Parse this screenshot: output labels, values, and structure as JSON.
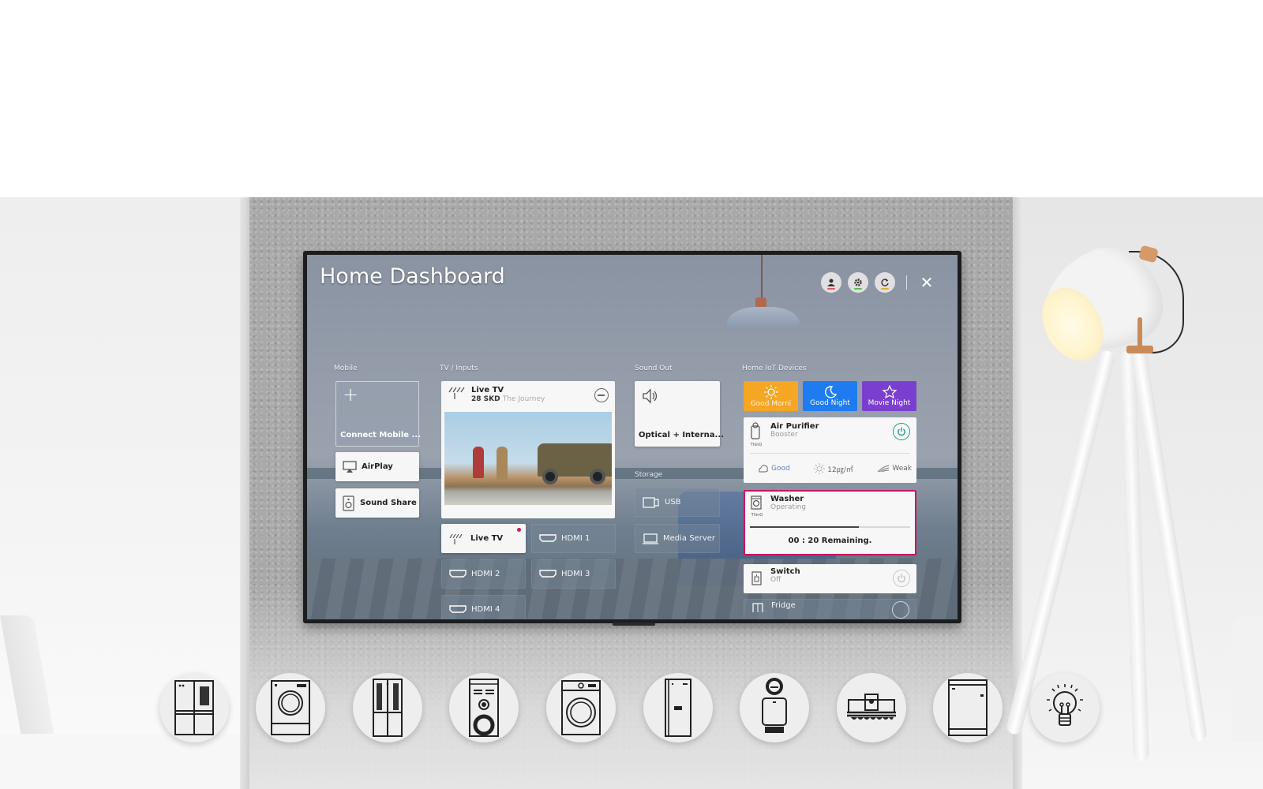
{
  "screen": {
    "title": "Home Dashboard",
    "top_icons": [
      {
        "name": "profile-icon",
        "indicator_color": "#e05a6a"
      },
      {
        "name": "settings-icon",
        "indicator_color": "#58c04a"
      },
      {
        "name": "refresh-icon",
        "indicator_color": "#e0b030"
      }
    ],
    "close_icon": "close-icon"
  },
  "mobile": {
    "label": "Mobile",
    "connect_label": "Connect Mobile ...",
    "items": [
      {
        "label": "AirPlay",
        "icon": "airplay-icon"
      },
      {
        "label": "Sound Share",
        "icon": "speaker-icon"
      }
    ]
  },
  "tv_inputs": {
    "label": "TV / Inputs",
    "live_card": {
      "title": "Live TV",
      "channel": "28 SKD",
      "program": "The Journey",
      "icon": "antenna-icon"
    },
    "inputs": [
      {
        "label": "Live TV",
        "icon": "antenna-icon",
        "active": true,
        "dot_color": "#d4145a"
      },
      {
        "label": "HDMI 1",
        "icon": "hdmi-icon",
        "active": false
      },
      {
        "label": "HDMI 2",
        "icon": "hdmi-icon",
        "active": false
      },
      {
        "label": "HDMI 3",
        "icon": "hdmi-icon",
        "active": false
      },
      {
        "label": "HDMI 4",
        "icon": "hdmi-icon",
        "active": false
      }
    ]
  },
  "sound_out": {
    "label": "Sound Out",
    "value": "Optical + Interna...",
    "icon": "volume-icon"
  },
  "storage": {
    "label": "Storage",
    "items": [
      {
        "label": "USB",
        "icon": "usb-icon"
      },
      {
        "label": "Media Server",
        "icon": "media-server-icon"
      }
    ]
  },
  "iot": {
    "label": "Home IoT Devices",
    "scenes": [
      {
        "label": "Good Morni",
        "icon": "sun-icon",
        "color": "#f5a623"
      },
      {
        "label": "Good Night",
        "icon": "moon-icon",
        "color": "#1f7cf0"
      },
      {
        "label": "Movie Night",
        "icon": "star-icon",
        "color": "#7b3fd0"
      }
    ],
    "devices": [
      {
        "name": "Air Purifier",
        "status": "Booster",
        "brand": "ThinQ",
        "power": "on",
        "power_color": "#1a9a8a",
        "metrics": [
          {
            "icon": "air-quality-icon",
            "value": "Good",
            "color": "#5a7fc0"
          },
          {
            "icon": "dust-icon",
            "value": "12㎍/㎥",
            "color": "#666666"
          },
          {
            "icon": "wind-icon",
            "value": "Weak",
            "color": "#666666"
          }
        ]
      },
      {
        "name": "Washer",
        "status": "Operating",
        "brand": "ThinQ",
        "progress": 0.68,
        "remaining": "00 : 20 Remaining.",
        "highlight_color": "#c8175d"
      },
      {
        "name": "Switch",
        "status": "Off",
        "power": "off"
      },
      {
        "name": "Fridge"
      }
    ]
  },
  "appliance_icons": [
    "french-door-fridge-icon",
    "washer-icon",
    "side-by-side-fridge-icon",
    "speaker-tower-icon",
    "front-load-washer-icon",
    "refrigerator-icon",
    "air-purifier-icon",
    "robot-cleaner-icon",
    "dishwasher-icon",
    "light-bulb-icon"
  ]
}
